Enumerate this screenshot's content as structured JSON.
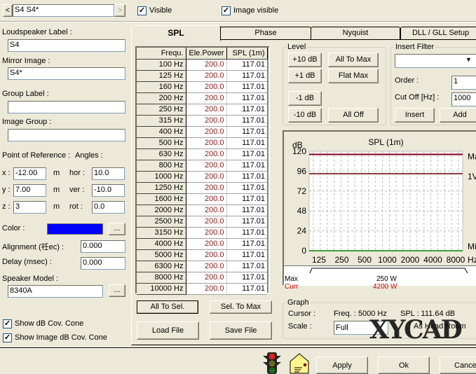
{
  "top": {
    "nav_value": "S4 S4*",
    "prev": "<",
    "next": ">",
    "visible_label": "Visible",
    "visible_checked": true,
    "image_visible_label": "Image visible",
    "image_visible_checked": true
  },
  "left": {
    "loudspeaker_label": "Loudspeaker Label :",
    "loudspeaker_value": "S4",
    "mirror_label": "Mirror Image :",
    "mirror_value": "S4*",
    "group_label": "Group Label :",
    "group_value": "",
    "image_group_label": "Image Group :",
    "image_group_value": "",
    "por_label": "Point of Reference :",
    "angles_label": "Angles :",
    "x_label": "x :",
    "x_value": "-12.00",
    "y_label": "y :",
    "y_value": "7.00",
    "z_label": "z :",
    "z_value": "3",
    "unit": "m",
    "hor_label": "hor :",
    "hor_value": "10.0",
    "ver_label": "ver :",
    "ver_value": "-10.0",
    "rot_label": "rot :",
    "rot_value": "0.0",
    "color_label": "Color :",
    "color": "#0000ff",
    "dots": "...",
    "alignment_label": "Alignment (祍ec) :",
    "alignment_value": "0.000",
    "delay_label": "Delay (msec) :",
    "delay_value": "0.000",
    "model_label": "Speaker Model :",
    "model_value": "8340A",
    "cone_label": "Show dB Cov. Cone",
    "cone_checked": true,
    "image_cone_label": "Show Image dB Cov. Cone",
    "image_cone_checked": true
  },
  "tabs": [
    {
      "label": "SPL",
      "active": true
    },
    {
      "label": "Phase"
    },
    {
      "label": "Nyquist"
    },
    {
      "label": "DLL / GLL Setup"
    }
  ],
  "table": {
    "headers": [
      "Frequ.",
      "Ele.Power",
      "SPL (1m)"
    ],
    "rows": [
      [
        "100 Hz",
        "200.0",
        "117.01"
      ],
      [
        "125 Hz",
        "200.0",
        "117.01"
      ],
      [
        "160 Hz",
        "200.0",
        "117.01"
      ],
      [
        "200 Hz",
        "200.0",
        "117.01"
      ],
      [
        "250 Hz",
        "200.0",
        "117.01"
      ],
      [
        "315 Hz",
        "200.0",
        "117.01"
      ],
      [
        "400 Hz",
        "200.0",
        "117.01"
      ],
      [
        "500 Hz",
        "200.0",
        "117.01"
      ],
      [
        "630 Hz",
        "200.0",
        "117.01"
      ],
      [
        "800 Hz",
        "200.0",
        "117.01"
      ],
      [
        "1000 Hz",
        "200.0",
        "117.01"
      ],
      [
        "1250 Hz",
        "200.0",
        "117.01"
      ],
      [
        "1600 Hz",
        "200.0",
        "117.01"
      ],
      [
        "2000 Hz",
        "200.0",
        "117.01"
      ],
      [
        "2500 Hz",
        "200.0",
        "117.01"
      ],
      [
        "3150 Hz",
        "200.0",
        "117.01"
      ],
      [
        "4000 Hz",
        "200.0",
        "117.01"
      ],
      [
        "5000 Hz",
        "200.0",
        "117.01"
      ],
      [
        "6300 Hz",
        "200.0",
        "117.01"
      ],
      [
        "8000 Hz",
        "200.0",
        "117.01"
      ],
      [
        "10000 Hz",
        "200.0",
        "117.01"
      ]
    ]
  },
  "table_buttons": {
    "all_to_sel": "All To Sel.",
    "sel_to_max": "Sel. To Max",
    "load": "Load File",
    "save": "Save File"
  },
  "level": {
    "title": "Level",
    "p10": "+10 dB",
    "p1": "+1 dB",
    "m1": "-1 dB",
    "m10": "-10 dB",
    "all_max": "All To Max",
    "flat_max": "Flat Max",
    "all_off": "All Off"
  },
  "filter": {
    "title": "Insert Filter",
    "type_value": "",
    "order_label": "Order :",
    "order_value": "1",
    "cutoff_label": "Cut Off [Hz] :",
    "cutoff_value": "1000",
    "insert": "Insert",
    "add": "Add"
  },
  "chart_data": {
    "type": "line",
    "title": "SPL (1m)",
    "ylabel": "dB",
    "xlabel": "Hz",
    "ylim": [
      0,
      120
    ],
    "yticks": [
      "0",
      "24",
      "48",
      "72",
      "96",
      "120"
    ],
    "xticks": [
      "125",
      "250",
      "500",
      "1000",
      "2000",
      "4000",
      "8000"
    ],
    "grid": true,
    "series": [
      {
        "name": "Max",
        "values_db": 117,
        "color": "#d08090"
      },
      {
        "name": "Curr",
        "values_db": 116,
        "color": "#800020"
      },
      {
        "name": "1V",
        "values_db": 93,
        "color": "#600000"
      },
      {
        "name": "Min",
        "values_db": 0,
        "color": "#008000"
      }
    ],
    "right_labels": [
      "Ma",
      "1V",
      "Mi"
    ]
  },
  "legend": {
    "max_label": "Max",
    "max_value": "250 W",
    "curr_label": "Curr",
    "curr_value": "4200 W",
    "curr_color": "#c00000"
  },
  "graph": {
    "title": "Graph",
    "cursor_label": "Cursor :",
    "freq": "Freq. : 5000 Hz",
    "spl": "SPL : 111.64 dB",
    "scale_label": "Scale :",
    "scale_value": "Full",
    "as_label": "As Head Room"
  },
  "watermark": "XYCAD.com",
  "bottom": {
    "apply": "Apply",
    "ok": "Ok",
    "cancel": "Cancel"
  }
}
